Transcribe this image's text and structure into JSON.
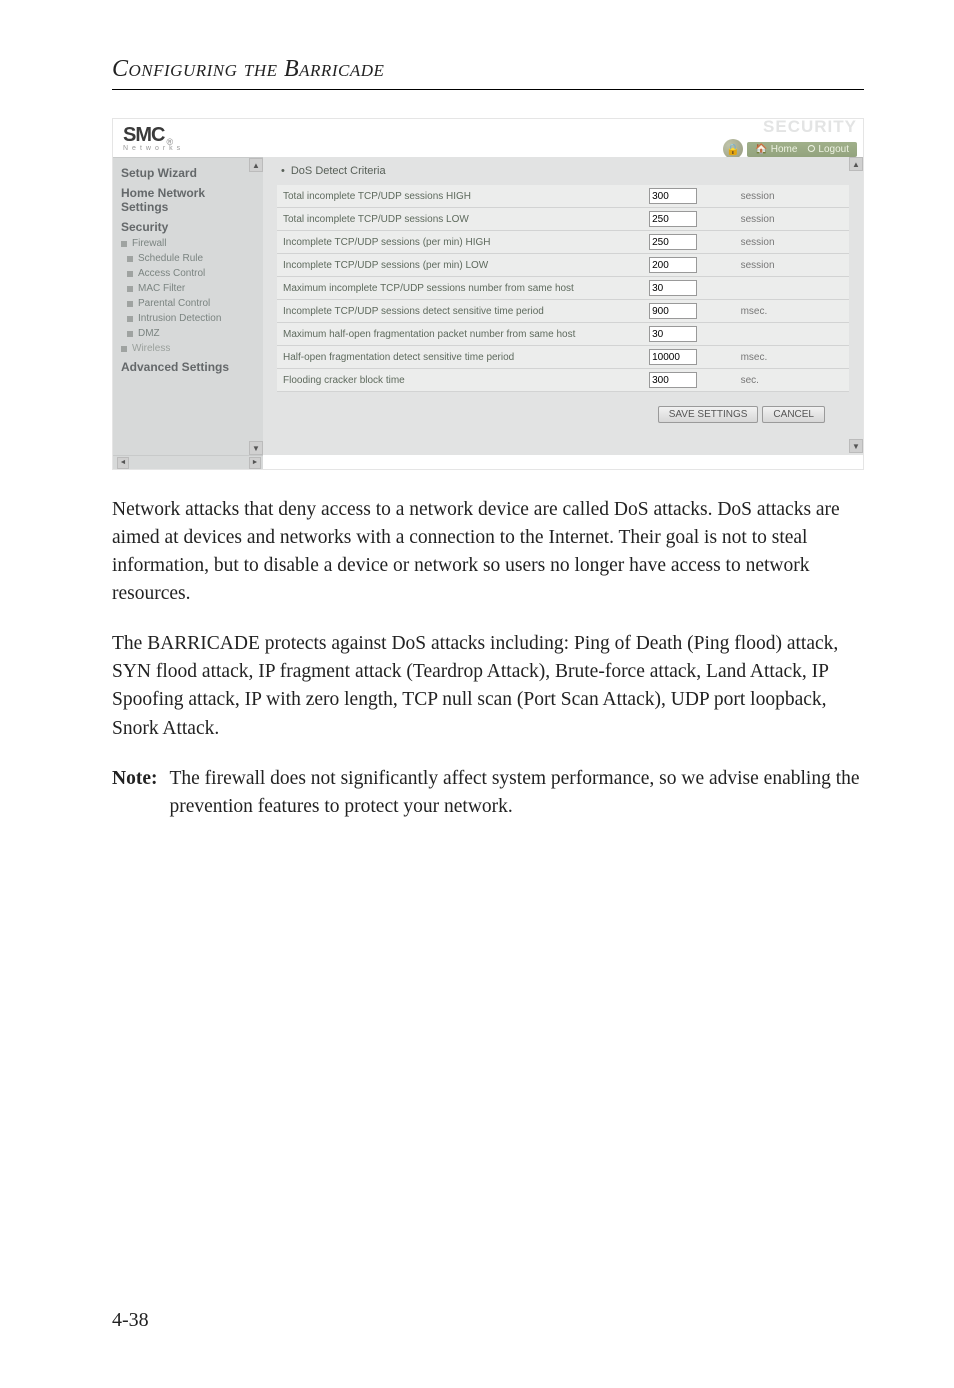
{
  "page": {
    "title_prefix": "Configuring the ",
    "title_main": "Barricade",
    "number": "4-38"
  },
  "screenshot": {
    "logo": {
      "text": "SMC",
      "sup": "®",
      "sub": "Networks"
    },
    "header_right": {
      "brand_word": "SECURITY",
      "links": {
        "home": "Home",
        "logout": "Logout"
      }
    },
    "sidebar": {
      "cats": [
        {
          "label": "Setup Wizard"
        },
        {
          "label": "Home Network Settings"
        },
        {
          "label": "Security"
        }
      ],
      "sec_items": [
        "Firewall",
        "Schedule Rule",
        "Access Control",
        "MAC Filter",
        "Parental Control",
        "Intrusion Detection",
        "DMZ"
      ],
      "more_cats": [
        "Wireless",
        "Advanced Settings"
      ]
    },
    "main": {
      "section_title": "DoS Detect Criteria",
      "rows": [
        {
          "label": "Total incomplete TCP/UDP sessions HIGH",
          "value": "300",
          "unit": "session"
        },
        {
          "label": "Total incomplete TCP/UDP sessions LOW",
          "value": "250",
          "unit": "session"
        },
        {
          "label": "Incomplete TCP/UDP sessions (per min) HIGH",
          "value": "250",
          "unit": "session"
        },
        {
          "label": "Incomplete TCP/UDP sessions (per min) LOW",
          "value": "200",
          "unit": "session"
        },
        {
          "label": "Maximum incomplete TCP/UDP sessions number from same host",
          "value": "30",
          "unit": ""
        },
        {
          "label": "Incomplete TCP/UDP sessions detect sensitive time period",
          "value": "900",
          "unit": "msec."
        },
        {
          "label": "Maximum half-open fragmentation packet number from same host",
          "value": "30",
          "unit": ""
        },
        {
          "label": "Half-open fragmentation detect sensitive time period",
          "value": "10000",
          "unit": "msec."
        },
        {
          "label": "Flooding cracker block time",
          "value": "300",
          "unit": "sec."
        }
      ],
      "buttons": {
        "save": "SAVE SETTINGS",
        "cancel": "CANCEL"
      }
    }
  },
  "paragraphs": {
    "p1": "Network attacks that deny access to a network device are called DoS attacks. DoS attacks are aimed at devices and networks with a connection to the Internet. Their goal is not to steal information, but to disable a device or network so users no longer have access to network resources.",
    "p2": "The BARRICADE protects against DoS attacks including: Ping of Death (Ping flood) attack, SYN flood attack, IP fragment attack (Teardrop Attack), Brute-force attack, Land Attack, IP Spoofing attack, IP with zero length, TCP null scan (Port Scan Attack), UDP port loopback, Snork Attack."
  },
  "note": {
    "label": "Note:",
    "text": "The firewall does not significantly affect system performance, so we advise enabling the prevention features to protect your network."
  }
}
